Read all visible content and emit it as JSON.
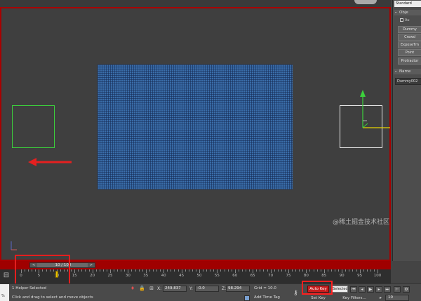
{
  "panel": {
    "dropdown_value": "Standard",
    "object_type_header": "Obje",
    "autogrid_label": "Au",
    "buttons": [
      "Dummy",
      "Crowd",
      "ExposeTm",
      "Point",
      "Protractor"
    ],
    "name_header": "Name",
    "object_name": "Dummy002"
  },
  "time_slider": {
    "label": "10 / 100",
    "prev": "<",
    "next": ">",
    "current_frame": 10,
    "total_frames": 100
  },
  "track_bar": {
    "ticks": [
      "0",
      "5",
      "10",
      "15",
      "20",
      "25",
      "30",
      "35",
      "40",
      "45",
      "50",
      "55",
      "60",
      "65",
      "70",
      "75",
      "80",
      "85",
      "90",
      "95",
      "100"
    ]
  },
  "status": {
    "selection": "1 Helper Selected",
    "prompt": "Click and drag to select and move objects",
    "maxscript_label": "%",
    "x_label": "X:",
    "x_value": "249.837",
    "y_label": "Y:",
    "y_value": "-0.0",
    "z_label": "Z:",
    "z_value": "98.294",
    "grid": "Grid = 10.0",
    "add_time_tag": "Add Time Tag",
    "auto_key": "Auto Key",
    "set_key": "Set Key",
    "selected_dropdown": "Selected",
    "key_filters": "Key Filters...",
    "frame": "10"
  },
  "watermark": "@稀土掘金技术社区",
  "colors": {
    "viewport_border": "#a80000",
    "plane": "#3a6da9",
    "auto_key": "#c81e1e",
    "highlight_box": "#e41e1e"
  },
  "icons": [
    "left-arrow-icon",
    "move-gizmo-icon",
    "axis-tripod-icon",
    "time-config-icon",
    "key-icon",
    "lock-icon",
    "isolate-icon",
    "play-icon"
  ]
}
